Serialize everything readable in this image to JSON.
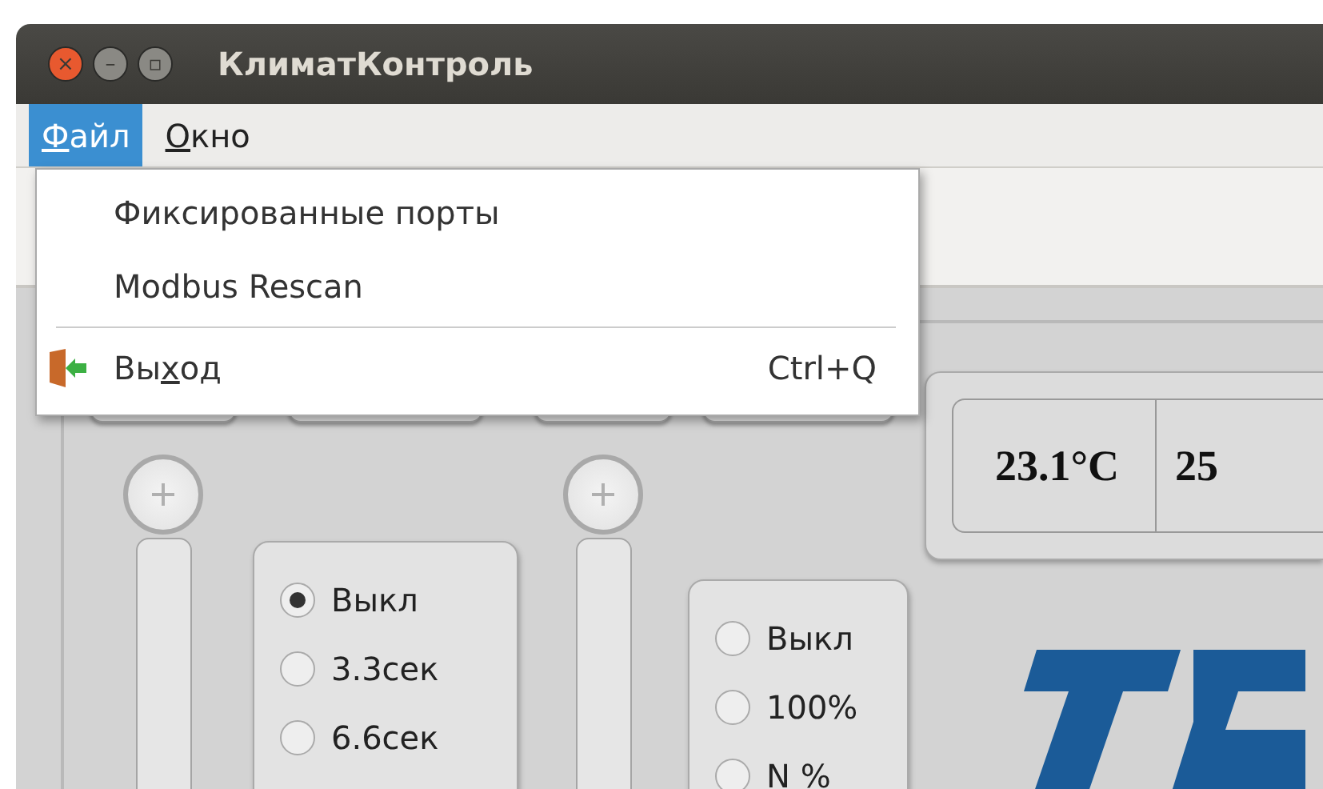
{
  "window": {
    "title": "КлиматКонтроль",
    "buttons": [
      "×",
      "–",
      "▫"
    ]
  },
  "menu_bar": [
    {
      "key": "Ф",
      "after": "айл",
      "selected": true
    },
    {
      "key": "О",
      "after": "кно",
      "selected": false
    }
  ],
  "open_menu": {
    "items": [
      {
        "kind": "item",
        "label": "Фиксированные порты"
      },
      {
        "kind": "item",
        "label": "Modbus Rescan"
      },
      {
        "kind": "separator"
      },
      {
        "kind": "exit",
        "before": "Вы",
        "key": "х",
        "after": "од",
        "shortcut": "Ctrl+Q"
      }
    ]
  },
  "controls": [
    {
      "kind": "slider"
    },
    {
      "kind": "radio",
      "options": [
        {
          "label": "Выкл",
          "selected": true
        },
        {
          "label": "3.3сек",
          "selected": false
        },
        {
          "label": "6.6сек",
          "selected": false
        }
      ]
    },
    {
      "kind": "slider"
    },
    {
      "kind": "radio",
      "options": [
        {
          "label": "Выкл",
          "selected": false
        },
        {
          "label": "100%",
          "selected": false
        },
        {
          "label": "N %",
          "selected": false
        }
      ]
    }
  ],
  "readings": [
    "23.1°C",
    "25"
  ]
}
